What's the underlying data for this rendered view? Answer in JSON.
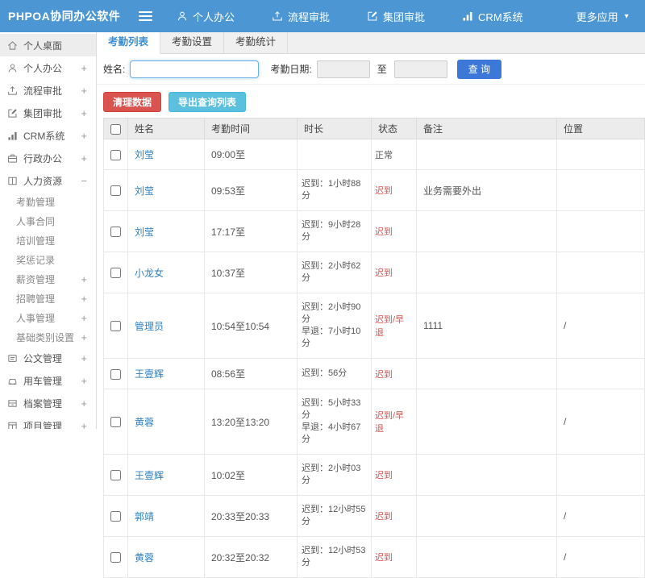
{
  "colors": {
    "navbar_blue": "#4b96d3",
    "active_tab_blue": "#3d8fd4",
    "query_button_blue": "#3b78d8",
    "danger_red": "#d9534f",
    "info_light_blue": "#5bc0de",
    "link_blue": "#2f80c0",
    "status_late_red": "#d9534f"
  },
  "navbar": {
    "logo": "PHPOA协同办公软件",
    "items": [
      {
        "label": "个人办公",
        "icon": "user-icon",
        "icon_ref": "#i-user",
        "suffix": ""
      },
      {
        "label": "流程审批",
        "icon": "flow-icon",
        "icon_ref": "#i-flow",
        "suffix": ""
      },
      {
        "label": "集团审批",
        "icon": "edit-icon",
        "icon_ref": "#i-edit",
        "suffix": ""
      },
      {
        "label": "CRM系统",
        "icon": "chart-icon",
        "icon_ref": "#i-chart",
        "suffix": ""
      },
      {
        "label": "更多应用",
        "icon": "none-icon",
        "icon_ref": "#i-none",
        "suffix": "▾"
      }
    ]
  },
  "sidebar": {
    "items": [
      {
        "label": "个人桌面",
        "icon": "home-icon",
        "icon_ref": "#i-home",
        "cls": "side-item active",
        "expand": ""
      },
      {
        "label": "个人办公",
        "icon": "user-icon",
        "icon_ref": "#i-user",
        "cls": "side-item",
        "expand": "+"
      },
      {
        "label": "流程审批",
        "icon": "flow-icon",
        "icon_ref": "#i-flow",
        "cls": "side-item",
        "expand": "+"
      },
      {
        "label": "集团审批",
        "icon": "edit-icon",
        "icon_ref": "#i-edit",
        "cls": "side-item",
        "expand": "+"
      },
      {
        "label": "CRM系统",
        "icon": "chart-icon",
        "icon_ref": "#i-chart",
        "cls": "side-item",
        "expand": "+"
      },
      {
        "label": "行政办公",
        "icon": "briefcase-icon",
        "icon_ref": "#i-case",
        "cls": "side-item",
        "expand": "+"
      },
      {
        "label": "人力资源",
        "icon": "book-icon",
        "icon_ref": "#i-book",
        "cls": "side-item",
        "expand": "−"
      },
      {
        "label": "考勤管理",
        "icon": "none-icon",
        "icon_ref": "#i-none",
        "cls": "side-item sub",
        "expand": ""
      },
      {
        "label": "人事合同",
        "icon": "none-icon",
        "icon_ref": "#i-none",
        "cls": "side-item sub",
        "expand": ""
      },
      {
        "label": "培训管理",
        "icon": "none-icon",
        "icon_ref": "#i-none",
        "cls": "side-item sub",
        "expand": ""
      },
      {
        "label": "奖惩记录",
        "icon": "none-icon",
        "icon_ref": "#i-none",
        "cls": "side-item sub",
        "expand": ""
      },
      {
        "label": "薪资管理",
        "icon": "none-icon",
        "icon_ref": "#i-none",
        "cls": "side-item sub",
        "expand": "+"
      },
      {
        "label": "招聘管理",
        "icon": "none-icon",
        "icon_ref": "#i-none",
        "cls": "side-item sub",
        "expand": "+"
      },
      {
        "label": "人事管理",
        "icon": "none-icon",
        "icon_ref": "#i-none",
        "cls": "side-item sub",
        "expand": "+"
      },
      {
        "label": "基础类别设置",
        "icon": "none-icon",
        "icon_ref": "#i-none",
        "cls": "side-item sub",
        "expand": "+"
      },
      {
        "label": "公文管理",
        "icon": "doc-icon",
        "icon_ref": "#i-doc",
        "cls": "side-item",
        "expand": "+"
      },
      {
        "label": "用车管理",
        "icon": "car-icon",
        "icon_ref": "#i-car",
        "cls": "side-item",
        "expand": "+"
      },
      {
        "label": "档案管理",
        "icon": "archive-icon",
        "icon_ref": "#i-archive",
        "cls": "side-item",
        "expand": "+"
      },
      {
        "label": "项目管理",
        "icon": "project-icon",
        "icon_ref": "#i-grid",
        "cls": "side-item",
        "expand": "+"
      }
    ]
  },
  "tabs": [
    {
      "label": "考勤列表",
      "cls": "tab active"
    },
    {
      "label": "考勤设置",
      "cls": "tab"
    },
    {
      "label": "考勤统计",
      "cls": "tab"
    }
  ],
  "form": {
    "name_label": "姓名:",
    "name_value": "",
    "date_label": "考勤日期:",
    "date_from": "",
    "to_label": "至",
    "date_to": "",
    "query_button": "查 询"
  },
  "actions": {
    "clean_button": "清理数据",
    "export_button": "导出查询列表"
  },
  "table": {
    "headers": [
      "姓名",
      "考勤时间",
      "时长",
      "状态",
      "备注",
      "位置"
    ],
    "rows": [
      {
        "name": "刘莹",
        "time": "09:00至",
        "duration": "",
        "status": "正常",
        "status_type": "ok",
        "note": "",
        "location": ""
      },
      {
        "name": "刘莹",
        "time": "09:53至",
        "duration": "迟到：1小时88分",
        "status": "迟到",
        "status_type": "late",
        "note": "业务需要外出",
        "location": ""
      },
      {
        "name": "刘莹",
        "time": "17:17至",
        "duration": "迟到：9小时28分",
        "status": "迟到",
        "status_type": "late",
        "note": "",
        "location": ""
      },
      {
        "name": "小龙女",
        "time": "10:37至",
        "duration": "迟到：2小时62分",
        "status": "迟到",
        "status_type": "late",
        "note": "",
        "location": ""
      },
      {
        "name": "管理员",
        "time": "10:54至10:54",
        "duration": "迟到：2小时90分\n早退：7小时10分",
        "status": "迟到/早退",
        "status_type": "late",
        "note": "1111",
        "location": "/"
      },
      {
        "name": "王壹辉",
        "time": "08:56至",
        "duration": "迟到：56分",
        "status": "迟到",
        "status_type": "late",
        "note": "",
        "location": ""
      },
      {
        "name": "黄蓉",
        "time": "13:20至13:20",
        "duration": "迟到：5小时33分\n早退：4小时67分",
        "status": "迟到/早退",
        "status_type": "late",
        "note": "",
        "location": "/"
      },
      {
        "name": "王壹辉",
        "time": "10:02至",
        "duration": "迟到：2小时03分",
        "status": "迟到",
        "status_type": "late",
        "note": "",
        "location": ""
      },
      {
        "name": "郭靖",
        "time": "20:33至20:33",
        "duration": "迟到：12小时55分",
        "status": "迟到",
        "status_type": "late",
        "note": "",
        "location": "/"
      },
      {
        "name": "黄蓉",
        "time": "20:32至20:32",
        "duration": "迟到：12小时53分",
        "status": "迟到",
        "status_type": "late",
        "note": "",
        "location": "/"
      }
    ]
  }
}
